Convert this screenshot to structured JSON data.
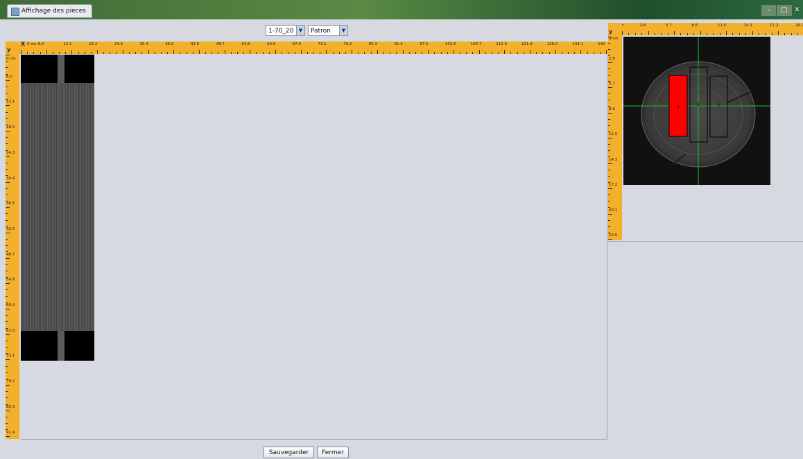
{
  "window": {
    "title": "Affichage des pieces",
    "controls": {
      "minimize": "–",
      "maximize": "□",
      "close": "x"
    }
  },
  "selectors": {
    "log_select": {
      "value": "1-70_20"
    },
    "mode_select": {
      "value": "Patron"
    }
  },
  "main_view": {
    "x_axis_label": "X",
    "y_axis_label": "y",
    "x_unit": "0 cm",
    "y_unit": "0 cm",
    "x_ticks": [
      "6.0",
      "12.1",
      "18.2",
      "24.3",
      "30.4",
      "36.5",
      "42.6",
      "48.7",
      "54.8",
      "60.9",
      "67.0",
      "73.1",
      "79.2",
      "85.3",
      "91.4",
      "97.5",
      "103.6",
      "109.7",
      "115.9",
      "121.9",
      "128.0",
      "134.1",
      "140"
    ],
    "y_ticks": [
      "6.0",
      "12.1",
      "18.2",
      "24.3",
      "30.4",
      "36.5",
      "42.6",
      "48.7",
      "54.8",
      "60.9",
      "67.0",
      "73.1",
      "79.2",
      "85.3",
      "91.4"
    ]
  },
  "section_view": {
    "x_axis_label": "X",
    "y_axis_label": "y",
    "x_unit": "0 cm",
    "y_unit": "0 cm",
    "x_ticks": [
      "2.8",
      "5.7",
      "8.6",
      "11.5",
      "14.3",
      "17.2",
      "20.1"
    ],
    "y_ticks": [
      "2.8",
      "5.7",
      "8.6",
      "11.5",
      "14.3",
      "17.2",
      "20.1",
      "23.0"
    ],
    "pieces": [
      {
        "label": "1",
        "color": "#ff0000",
        "selected": true
      },
      {
        "label": "2",
        "color": "#000000",
        "selected": false
      },
      {
        "label": "3",
        "color": "#000000",
        "selected": false
      }
    ],
    "crosshair_color": "#1fc21f"
  },
  "buttons": {
    "save": "Sauvegarder",
    "close": "Fermer"
  }
}
